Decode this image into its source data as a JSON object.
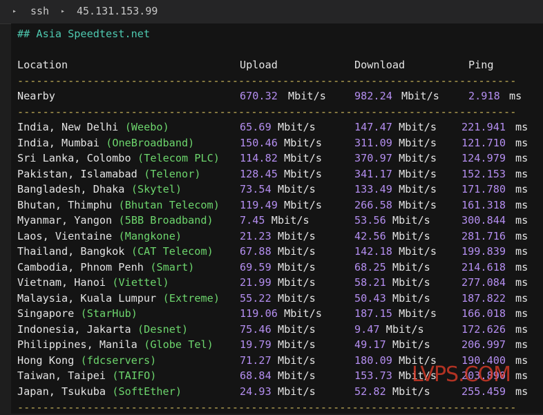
{
  "topbar": {
    "crumb1": "ssh",
    "crumb2": "45.131.153.99"
  },
  "terminal": {
    "heading": "## Asia Speedtest.net",
    "columns": {
      "location": "Location",
      "upload": "Upload",
      "download": "Download",
      "ping": "Ping"
    },
    "dashes": "------------------------------------------------------------------------------------------------------",
    "nearby": {
      "location": "Nearby",
      "upload": "670.32",
      "download": "982.24",
      "ping": "2.918"
    },
    "units": {
      "speed": "Mbit/s",
      "ping": "ms"
    },
    "rows": [
      {
        "place": "India, New Delhi",
        "isp": "(Weebo)",
        "upload": "65.69",
        "download": "147.47",
        "ping": "221.941"
      },
      {
        "place": "India, Mumbai",
        "isp": "(OneBroadband)",
        "upload": "150.46",
        "download": "311.09",
        "ping": "121.710"
      },
      {
        "place": "Sri Lanka, Colombo",
        "isp": "(Telecom PLC)",
        "upload": "114.82",
        "download": "370.97",
        "ping": "124.979"
      },
      {
        "place": "Pakistan, Islamabad",
        "isp": "(Telenor)",
        "upload": "128.45",
        "download": "341.17",
        "ping": "152.153"
      },
      {
        "place": "Bangladesh, Dhaka",
        "isp": "(Skytel)",
        "upload": "73.54",
        "download": "133.49",
        "ping": "171.780"
      },
      {
        "place": "Bhutan, Thimphu",
        "isp": "(Bhutan Telecom)",
        "upload": "119.49",
        "download": "266.58",
        "ping": "161.318"
      },
      {
        "place": "Myanmar, Yangon",
        "isp": "(5BB Broadband)",
        "upload": "7.45",
        "download": "53.56",
        "ping": "300.844"
      },
      {
        "place": "Laos, Vientaine",
        "isp": "(Mangkone)",
        "upload": "21.23",
        "download": "42.56",
        "ping": "281.716"
      },
      {
        "place": "Thailand, Bangkok",
        "isp": "(CAT Telecom)",
        "upload": "67.88",
        "download": "142.18",
        "ping": "199.839"
      },
      {
        "place": "Cambodia, Phnom Penh",
        "isp": "(Smart)",
        "upload": "69.59",
        "download": "68.25",
        "ping": "214.618"
      },
      {
        "place": "Vietnam, Hanoi",
        "isp": "(Viettel)",
        "upload": "21.99",
        "download": "58.21",
        "ping": "277.084"
      },
      {
        "place": "Malaysia, Kuala Lumpur",
        "isp": "(Extreme)",
        "upload": "55.22",
        "download": "50.43",
        "ping": "187.822"
      },
      {
        "place": "Singapore",
        "isp": "(StarHub)",
        "upload": "119.06",
        "download": "187.15",
        "ping": "166.018"
      },
      {
        "place": "Indonesia, Jakarta",
        "isp": "(Desnet)",
        "upload": "75.46",
        "download": "9.47",
        "ping": "172.626"
      },
      {
        "place": "Philippines, Manila",
        "isp": "(Globe Tel)",
        "upload": "19.79",
        "download": "49.17",
        "ping": "206.997"
      },
      {
        "place": "Hong Kong",
        "isp": "(fdcservers)",
        "upload": "71.27",
        "download": "180.09",
        "ping": "190.400"
      },
      {
        "place": "Taiwan, Taipei",
        "isp": "(TAIFO)",
        "upload": "68.84",
        "download": "153.73",
        "ping": "203.890"
      },
      {
        "place": "Japan, Tsukuba",
        "isp": "(SoftEther)",
        "upload": "24.93",
        "download": "52.82",
        "ping": "255.459"
      }
    ]
  },
  "watermark": "LVPS.COM"
}
